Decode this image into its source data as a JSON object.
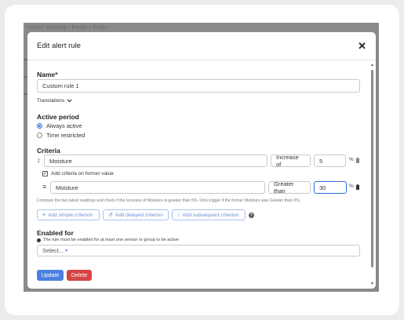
{
  "background": {
    "breadcrumb": "Ocean Sensing • Fields • Rules"
  },
  "modal": {
    "title": "Edit alert rule",
    "close_icon": "close-icon"
  },
  "name_field": {
    "label": "Name*",
    "value": "Custom rule 1",
    "translations_label": "Translations"
  },
  "active_period": {
    "label": "Active period",
    "options": [
      {
        "label": "Always active",
        "selected": true
      },
      {
        "label": "Time restricted",
        "selected": false
      }
    ]
  },
  "criteria": {
    "label": "Criteria",
    "rows": [
      {
        "metric": "Moisture",
        "operator": "Increase of",
        "value": "5",
        "unit": "%"
      },
      {
        "metric": "Moisture",
        "operator": "Greater than",
        "value": "30",
        "unit": "%"
      }
    ],
    "former_value_checkbox": {
      "label": "Add criteria on former value",
      "checked": true
    },
    "summary": "Compare the two latest readings and check if the Increase of Moisture is greater than 5%. Only trigger if the former Moisture was Greater than 0%.",
    "add_simple": "Add simple criterion",
    "add_delayed": "Add delayed criterion",
    "add_subsequent": "Add subsequent criterion"
  },
  "enabled_for": {
    "label": "Enabled for",
    "hint": "The rule must be enabled for at least one sensor or group to be active",
    "select_placeholder": "Select..."
  },
  "actions": {
    "update": "Update",
    "delete": "Delete"
  },
  "colors": {
    "primary": "#4b7fe0",
    "danger": "#d64545",
    "outline_text": "#6c8fd5"
  }
}
